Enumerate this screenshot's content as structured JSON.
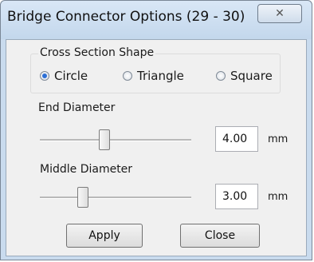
{
  "window": {
    "title": "Bridge Connector Options  (29 - 30)",
    "close_glyph": "✕"
  },
  "cross_section": {
    "label": "Cross Section Shape",
    "options": [
      {
        "label": "Circle",
        "selected": true
      },
      {
        "label": "Triangle",
        "selected": false
      },
      {
        "label": "Square",
        "selected": false
      }
    ]
  },
  "end_diameter": {
    "label": "End Diameter",
    "value": "4.00",
    "unit": "mm"
  },
  "middle_diameter": {
    "label": "Middle Diameter",
    "value": "3.00",
    "unit": "mm"
  },
  "buttons": {
    "apply": "Apply",
    "close": "Close"
  },
  "colors": {
    "frame": "#c9dbee",
    "client_bg": "#f0f0f0",
    "radio_accent": "#2c6fd6"
  }
}
